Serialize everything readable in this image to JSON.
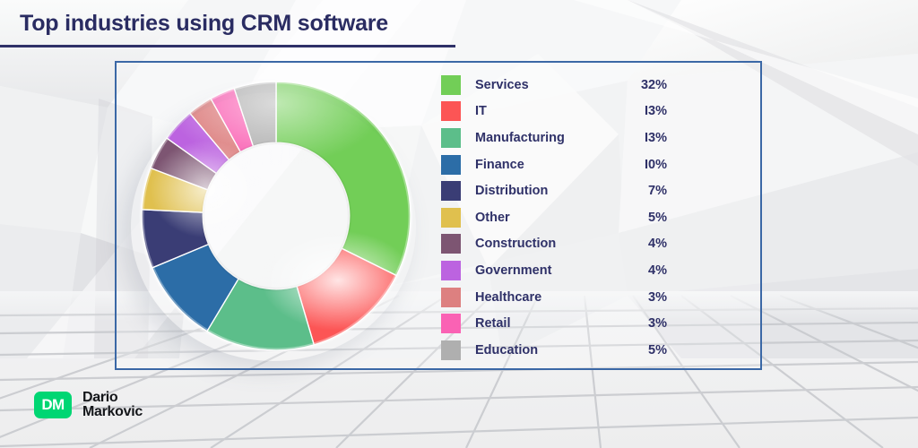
{
  "page": {
    "title": "Top industries using CRM software",
    "frame_border_color": "#3b68a6",
    "title_color": "#2f3168"
  },
  "logo": {
    "mark_text": "DM",
    "mark_color": "#00d673",
    "line1": "Dario",
    "line2": "Markovic"
  },
  "chart_data": {
    "type": "pie",
    "variant": "donut",
    "title": "Top industries using CRM software",
    "unit": "%",
    "start_angle_deg": 0,
    "direction": "clockwise",
    "inner_radius_ratio": 0.545,
    "categories": [
      "Services",
      "IT",
      "Manufacturing",
      "Finance",
      "Distribution",
      "Other",
      "Construction",
      "Government",
      "Healthcare",
      "Retail",
      "Education"
    ],
    "values": [
      32,
      13,
      13,
      10,
      7,
      5,
      4,
      4,
      3,
      3,
      5
    ],
    "labels": [
      "32%",
      "I3%",
      "I3%",
      "I0%",
      "7%",
      "5%",
      "4%",
      "4%",
      "3%",
      "3%",
      "5%"
    ],
    "colors": [
      "#72ce57",
      "#fc5555",
      "#5cbe8a",
      "#2c6da7",
      "#3a3d75",
      "#e0c04e",
      "#7d5572",
      "#bc63e0",
      "#dd8080",
      "#fa62b4",
      "#afafaf"
    ],
    "legend": {
      "position": "right",
      "entries": [
        {
          "label": "Services",
          "value": "32%",
          "color": "#72ce57"
        },
        {
          "label": "IT",
          "value": "I3%",
          "color": "#fc5555"
        },
        {
          "label": "Manufacturing",
          "value": "I3%",
          "color": "#5cbe8a"
        },
        {
          "label": "Finance",
          "value": "I0%",
          "color": "#2c6da7"
        },
        {
          "label": "Distribution",
          "value": "7%",
          "color": "#3a3d75"
        },
        {
          "label": "Other",
          "value": "5%",
          "color": "#e0c04e"
        },
        {
          "label": "Construction",
          "value": "4%",
          "color": "#7d5572"
        },
        {
          "label": "Government",
          "value": "4%",
          "color": "#bc63e0"
        },
        {
          "label": "Healthcare",
          "value": "3%",
          "color": "#dd8080"
        },
        {
          "label": "Retail",
          "value": "3%",
          "color": "#fa62b4"
        },
        {
          "label": "Education",
          "value": "5%",
          "color": "#afafaf"
        }
      ]
    }
  }
}
